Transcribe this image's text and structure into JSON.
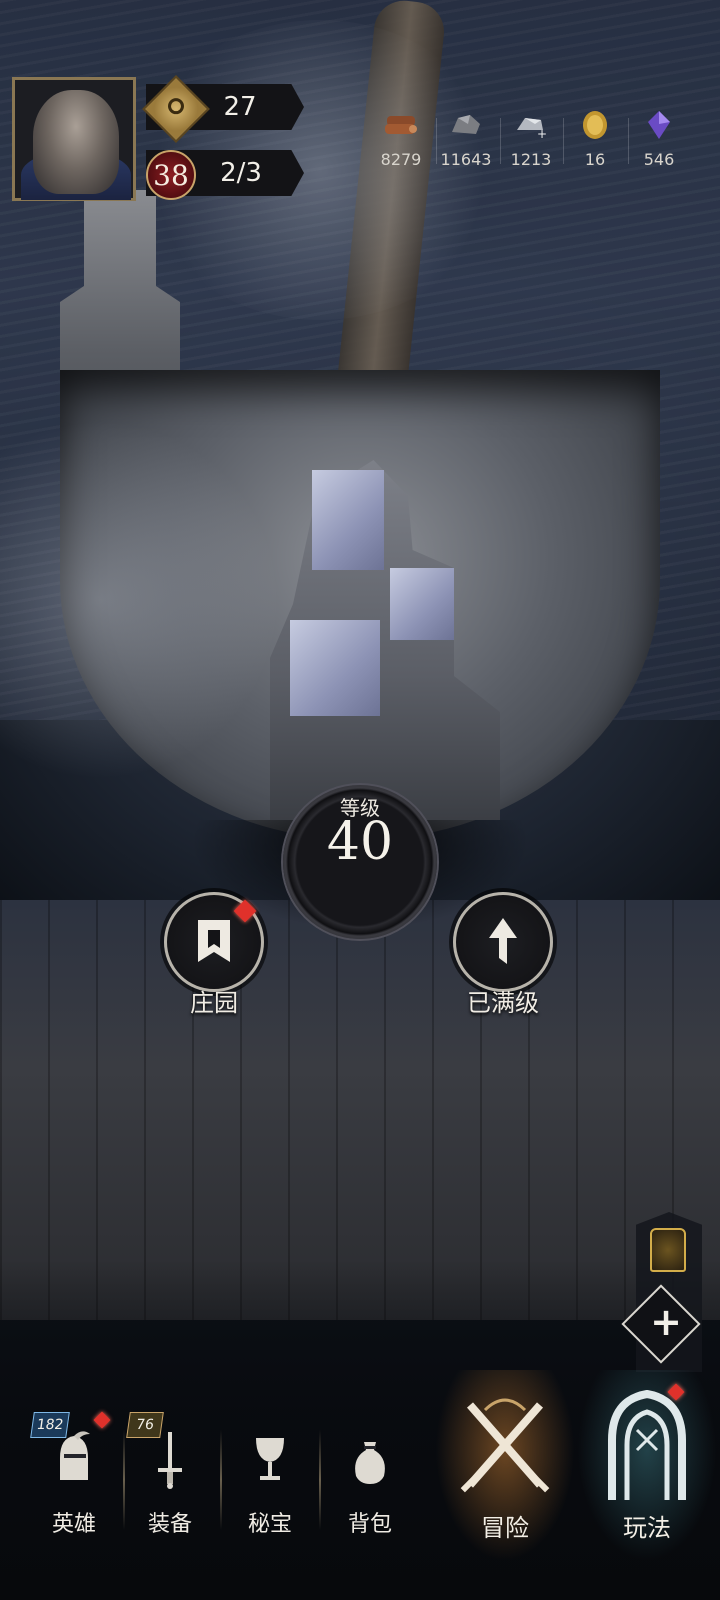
{
  "player": {
    "hero_badge_value": "27",
    "level_badge": "38",
    "energy": "2/3"
  },
  "resources": [
    {
      "name": "wood",
      "icon": "wood-icon",
      "value": "8279"
    },
    {
      "name": "stone",
      "icon": "stone-icon",
      "value": "11643"
    },
    {
      "name": "iron",
      "icon": "iron-icon",
      "value": "1213"
    },
    {
      "name": "gold",
      "icon": "gold-coin-icon",
      "value": "16"
    },
    {
      "name": "crystal",
      "icon": "crystal-icon",
      "value": "546"
    }
  ],
  "castle": {
    "level_label": "等级",
    "level_value": "40",
    "estate_label": "庄园",
    "upgrade_label": "已满级"
  },
  "nav": {
    "heroes": {
      "label": "英雄",
      "count": "182"
    },
    "equipment": {
      "label": "装备",
      "count": "76"
    },
    "treasure": {
      "label": "秘宝"
    },
    "bag": {
      "label": "背包"
    },
    "adventure": {
      "label": "冒险"
    },
    "gameplay": {
      "label": "玩法"
    }
  },
  "colors": {
    "accent_gold": "#c9a46a",
    "alert_red": "#e0312b",
    "text_light": "#f0ece4"
  }
}
